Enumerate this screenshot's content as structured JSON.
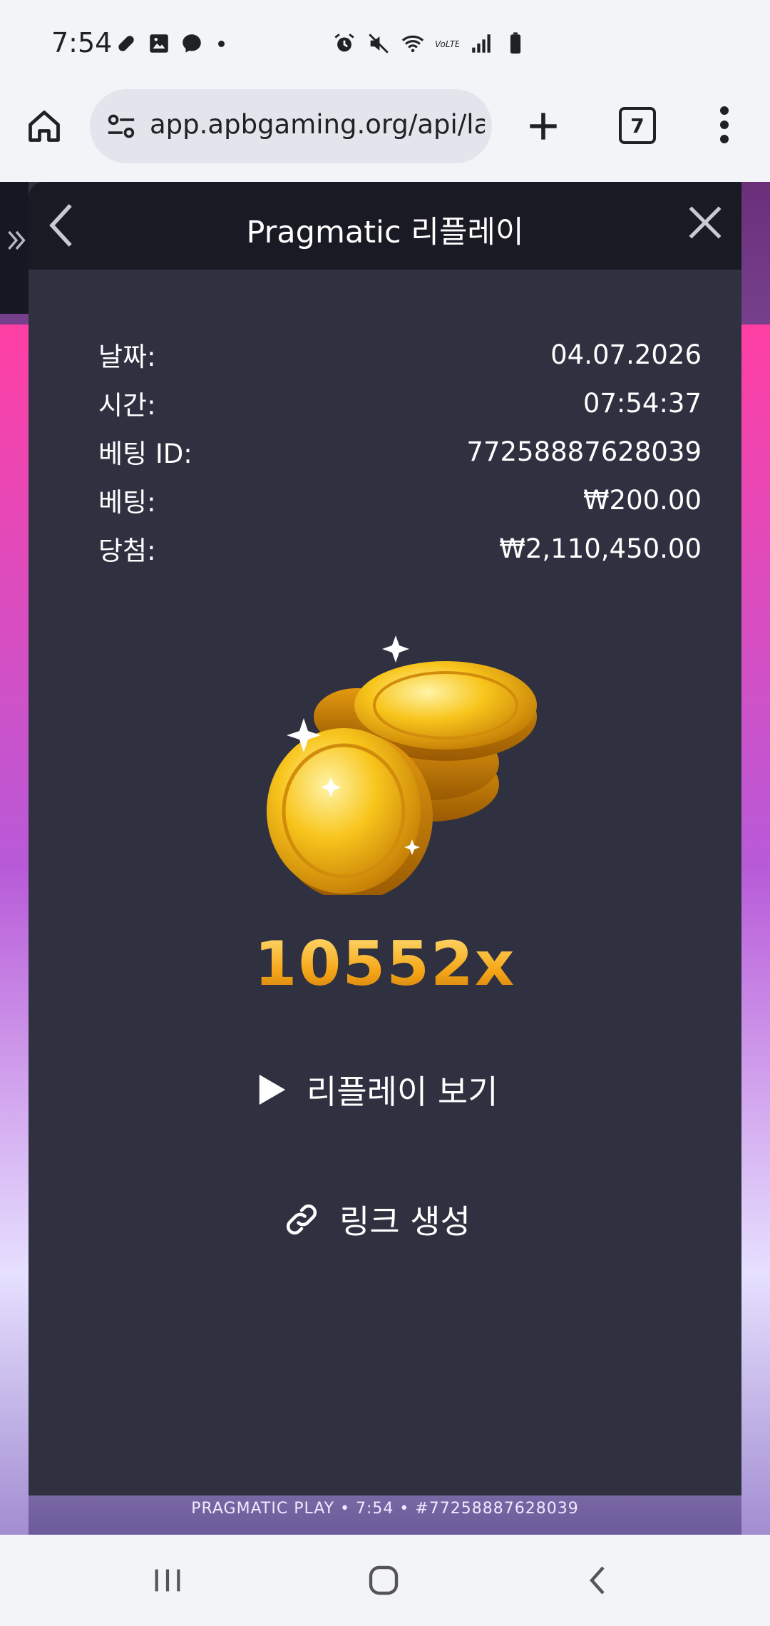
{
  "status_bar": {
    "time": "7:54",
    "left_icons": [
      "pill-icon",
      "image-icon",
      "messenger-icon"
    ],
    "right_icons": [
      "alarm-icon",
      "mute-icon",
      "wifi-icon",
      "volte-icon",
      "signal-icon",
      "battery-icon"
    ]
  },
  "browser": {
    "url": "app.apbgaming.org/api/lau",
    "tab_count": "7"
  },
  "panel": {
    "title": "Pragmatic 리플레이",
    "rows": [
      {
        "label": "날짜:",
        "value": "04.07.2026"
      },
      {
        "label": "시간:",
        "value": "07:54:37"
      },
      {
        "label": "베팅 ID:",
        "value": "77258887628039"
      },
      {
        "label": "베팅:",
        "value": "₩200.00"
      },
      {
        "label": "당첨:",
        "value": "₩2,110,450.00"
      }
    ],
    "multiplier": "10552x",
    "replay_label": "리플레이 보기",
    "link_label": "링크 생성"
  },
  "game": {
    "footer_text": "PRAGMATIC PLAY • 7:54 • #77258887628039"
  },
  "colors": {
    "panel_bg": "#2f3040",
    "header_bg": "#191a24",
    "multiplier_gold": "#f5a617"
  }
}
